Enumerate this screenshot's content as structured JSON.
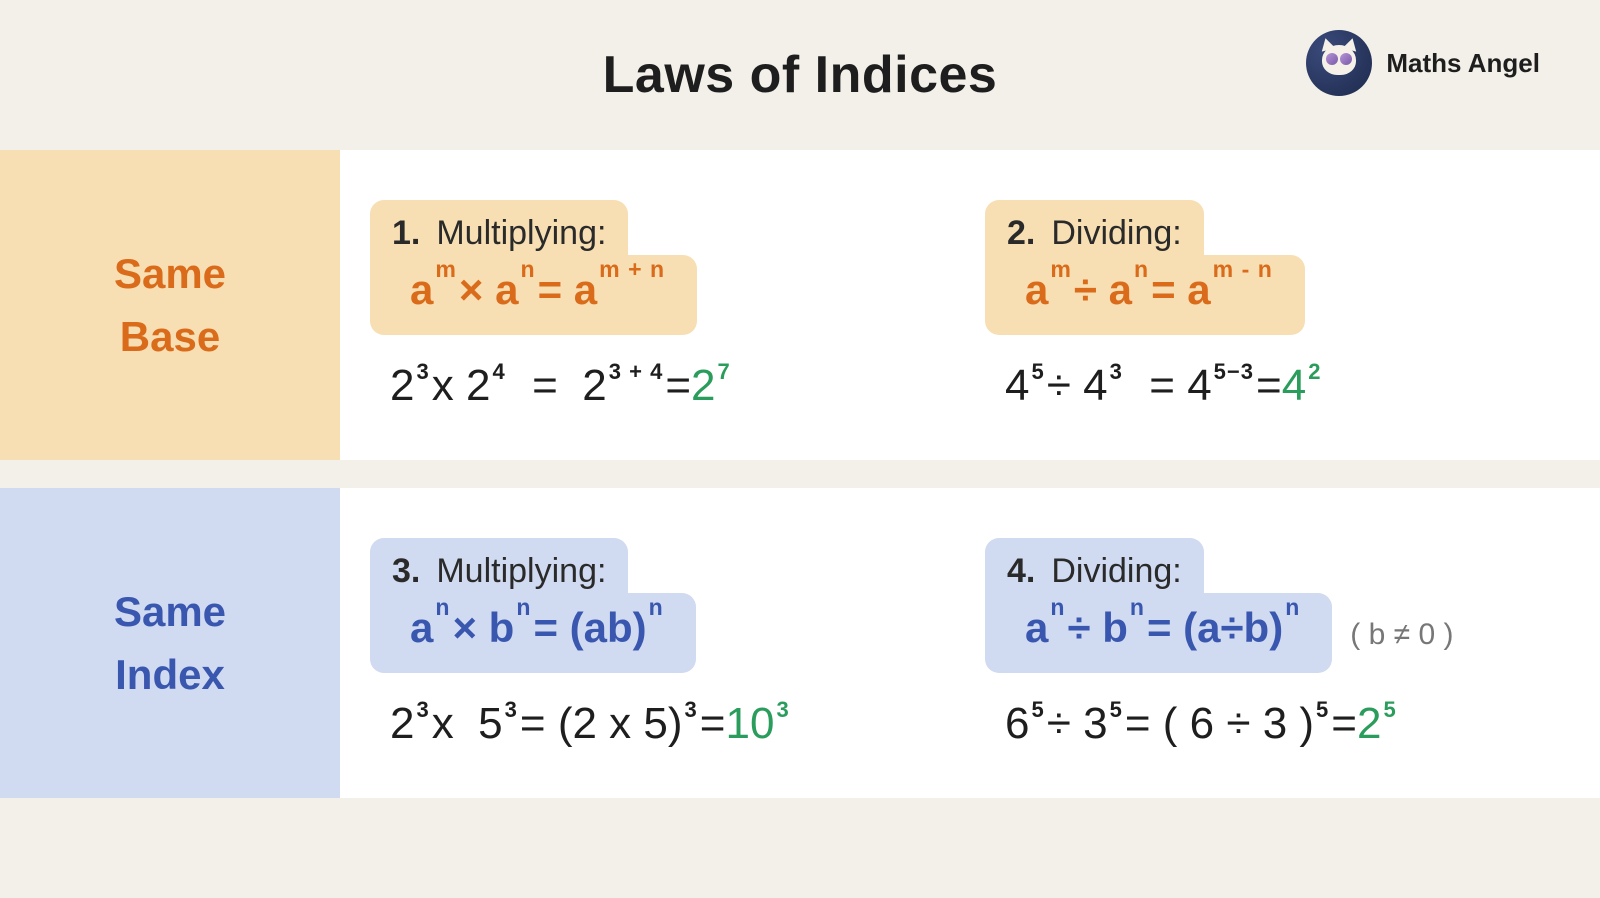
{
  "title": "Laws of Indices",
  "brand": "Maths Angel",
  "row1": {
    "label1": "Same",
    "label2": "Base",
    "cell1": {
      "num": "1.",
      "name": "Multiplying:",
      "formula_html": "a<span class='ssup'>m</span> × a<span class='ssup'>n</span> = a<span class='ssup'>m + n</span>",
      "example_html": "2<span class='ssup'>3</span> x 2<span class='ssup'>4</span>&nbsp; = &nbsp;2<span class='ssup'>3 + 4</span> = <span class='green'>2<span class='ssup'>7</span></span>"
    },
    "cell2": {
      "num": "2.",
      "name": "Dividing:",
      "formula_html": "a<span class='ssup'>m</span> ÷ a<span class='ssup'>n</span> = a<span class='ssup'>m - n</span>",
      "example_html": "4<span class='ssup'>5</span> ÷ 4<span class='ssup'>3</span>&nbsp; = 4<span class='ssup'>5−3</span> = <span class='green'>4<span class='ssup'>2</span></span>"
    }
  },
  "row2": {
    "label1": "Same",
    "label2": "Index",
    "cell3": {
      "num": "3.",
      "name": "Multiplying:",
      "formula_html": "a<span class='ssup'>n</span> × b<span class='ssup'>n</span> = (ab)<span class='ssup'>n</span>",
      "example_html": "2<span class='ssup'>3</span> x &nbsp;5<span class='ssup'>3</span> = (2 x 5)<span class='ssup'>3</span> = <span class='green'>10<span class='ssup'>3</span></span>"
    },
    "cell4": {
      "num": "4.",
      "name": "Dividing:",
      "formula_html": "a<span class='ssup'>n</span> ÷ b<span class='ssup'>n</span> = (a÷b)<span class='ssup'>n</span>",
      "note": "( b ≠ 0 )",
      "example_html": "6<span class='ssup'>5</span> ÷ 3<span class='ssup'>5</span> = ( 6 ÷ 3 )<span class='ssup'>5</span> = <span class='green'>2<span class='ssup'>5</span></span>"
    }
  }
}
